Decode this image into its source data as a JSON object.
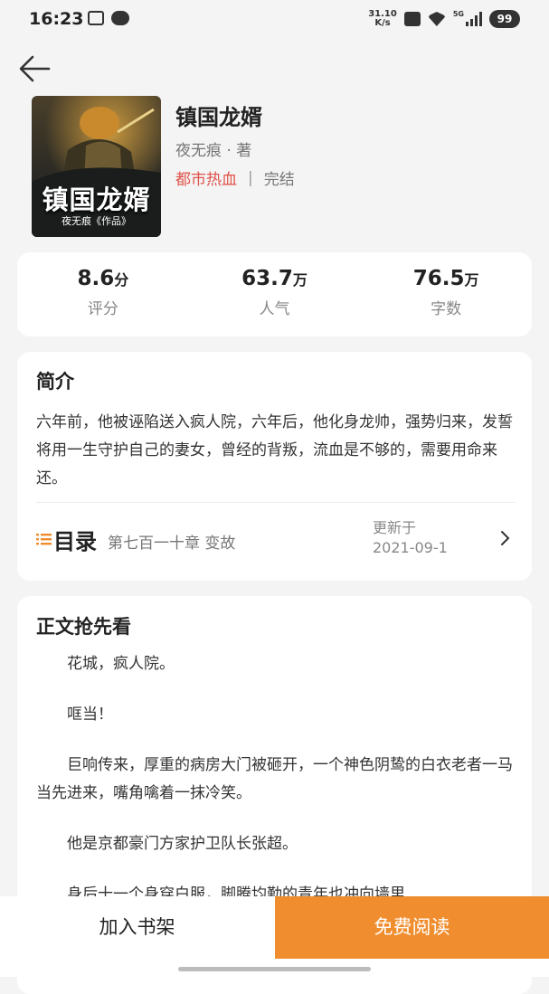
{
  "status_bar": {
    "time": "16:23",
    "net_speed_value": "31.10",
    "net_speed_unit": "K/s",
    "network_label": "5G",
    "battery": "99",
    "icons": [
      "screenshot-icon",
      "chat-icon",
      "mute-icon",
      "wifi-icon",
      "signal-icon",
      "battery-icon"
    ]
  },
  "book": {
    "cover_title": "镇国龙婿",
    "cover_author": "夜无痕《作品》",
    "title": "镇国龙婿",
    "author": "夜无痕 · 著",
    "genre": "都市热血",
    "separator": "|",
    "status": "完结"
  },
  "stats": [
    {
      "value": "8.6",
      "unit": "分",
      "label": "评分"
    },
    {
      "value": "63.7",
      "unit": "万",
      "label": "人气"
    },
    {
      "value": "76.5",
      "unit": "万",
      "label": "字数"
    }
  ],
  "intro": {
    "title": "简介",
    "text": "六年前，他被诬陷送入疯人院，六年后，他化身龙帅，强势归来，发誓将用一生守护自己的妻女，曾经的背叛，流血是不够的，需要用命来还。"
  },
  "toc": {
    "label": "目录",
    "latest_chapter": "第七百一十章  变故",
    "updated_label": "更新于",
    "updated_date": "2021-09-1"
  },
  "preview": {
    "title": "正文抢先看",
    "paragraphs": [
      "花城，疯人院。",
      "哐当！",
      "巨响传来，厚重的病房大门被砸开，一个神色阴鸷的白衣老者一马当先进来，嘴角噙着一抹冷笑。",
      "他是京都豪门方家护卫队长张超。",
      "身后十一个身穿白服，脚腾均勤的青年也冲向墙里"
    ]
  },
  "actions": {
    "add_shelf": "加入书架",
    "free_read": "免费阅读"
  },
  "colors": {
    "accent": "#f08d2e",
    "genre": "#e0524a",
    "background": "#f4f4f4"
  }
}
